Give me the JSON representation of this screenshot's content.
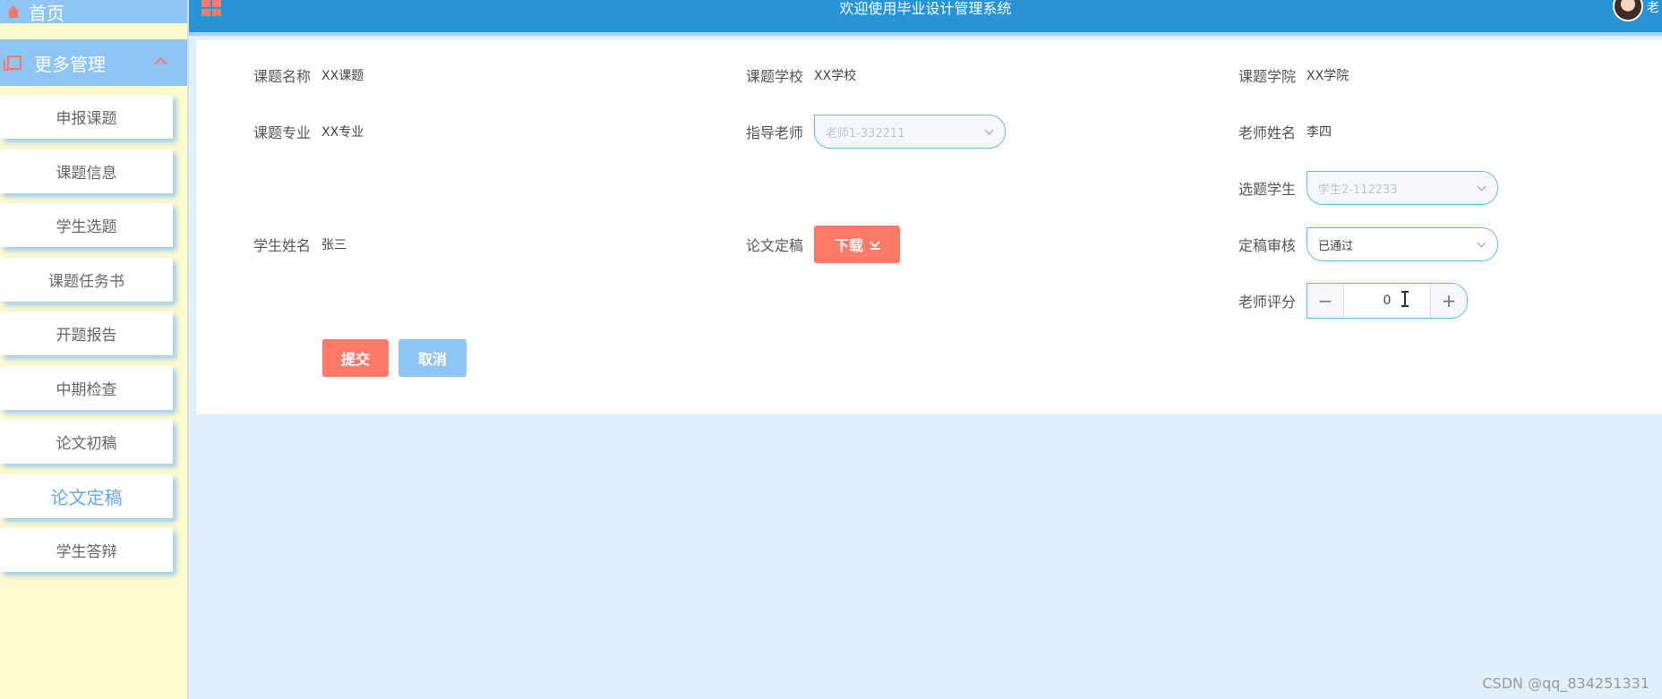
{
  "sidebar": {
    "home_label": "首页",
    "more_label": "更多管理",
    "items": [
      {
        "label": "申报课题"
      },
      {
        "label": "课题信息"
      },
      {
        "label": "学生选题"
      },
      {
        "label": "课题任务书"
      },
      {
        "label": "开题报告"
      },
      {
        "label": "中期检查"
      },
      {
        "label": "论文初稿"
      },
      {
        "label": "论文定稿"
      },
      {
        "label": "学生答辩"
      }
    ],
    "active_item": "论文定稿"
  },
  "header": {
    "title": "欢迎使用毕业设计管理系统",
    "user": "老"
  },
  "form": {
    "topic_name": {
      "label": "课题名称",
      "value": "XX课题"
    },
    "topic_school": {
      "label": "课题学校",
      "value": "XX学校"
    },
    "topic_college": {
      "label": "课题学院",
      "value": "XX学院"
    },
    "topic_major": {
      "label": "课题专业",
      "value": "XX专业"
    },
    "advisor": {
      "label": "指导老师",
      "value": "老师1-332211"
    },
    "teacher_name": {
      "label": "老师姓名",
      "value": "李四"
    },
    "student_select": {
      "label": "选题学生",
      "value": "学生2-112233"
    },
    "student_name": {
      "label": "学生姓名",
      "value": "张三"
    },
    "final_paper": {
      "label": "论文定稿",
      "button": "下载"
    },
    "review": {
      "label": "定稿审核",
      "value": "已通过"
    },
    "score": {
      "label": "老师评分",
      "value": "0",
      "minus": "−",
      "plus": "+"
    },
    "submit_label": "提交",
    "cancel_label": "取消"
  },
  "watermark": "CSDN @qq_834251331",
  "colors": {
    "accent": "#2894d8",
    "primary_button": "#ff7a68",
    "secondary_button": "#8fc5f5",
    "sidebar_bg": "#fffbcc",
    "page_bg": "#dfeffc"
  }
}
